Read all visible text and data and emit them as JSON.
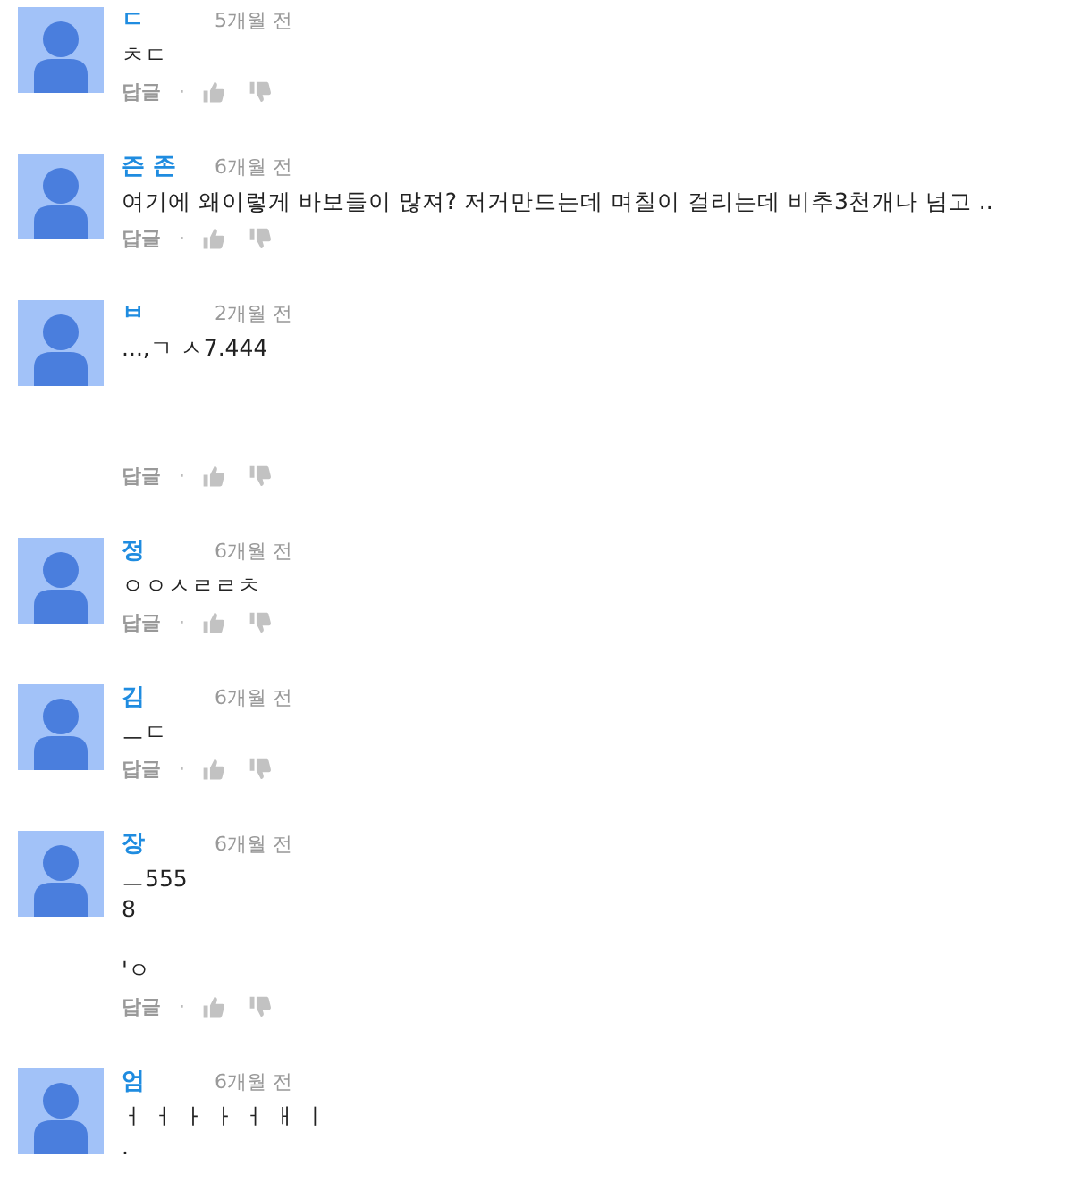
{
  "comments": [
    {
      "author": "ㄷ",
      "time": "5개월 전",
      "body": "ㅊㄷ",
      "reply_label": "답글",
      "separator": "·"
    },
    {
      "author": "즌 존",
      "time": "6개월 전",
      "body": "여기에 왜이렇게 바보들이 많져? 저거만드는데 며칠이 걸리는데 비추3천개나 넘고 ..",
      "reply_label": "답글",
      "separator": "·"
    },
    {
      "author": "ㅂ",
      "time": "2개월 전",
      "body": "...,ㄱ ㅅ7.444\n\n\n",
      "reply_label": "답글",
      "separator": "·"
    },
    {
      "author": "정",
      "time": "6개월 전",
      "body": "ㅇㅇㅅㄹㄹㅊ",
      "reply_label": "답글",
      "separator": "·"
    },
    {
      "author": "김",
      "time": "6개월 전",
      "body": "ㅡㄷ",
      "reply_label": "답글",
      "separator": "·"
    },
    {
      "author": "장",
      "time": "6개월 전",
      "body": "ㅡ555\n8\n\n'ㅇ",
      "reply_label": "답글",
      "separator": "·"
    },
    {
      "author": "엄",
      "time": "6개월 전",
      "body": "ㅓ ㅓ ㅏ ㅏ ㅓ ㅐ ㅣ\n."
    }
  ]
}
